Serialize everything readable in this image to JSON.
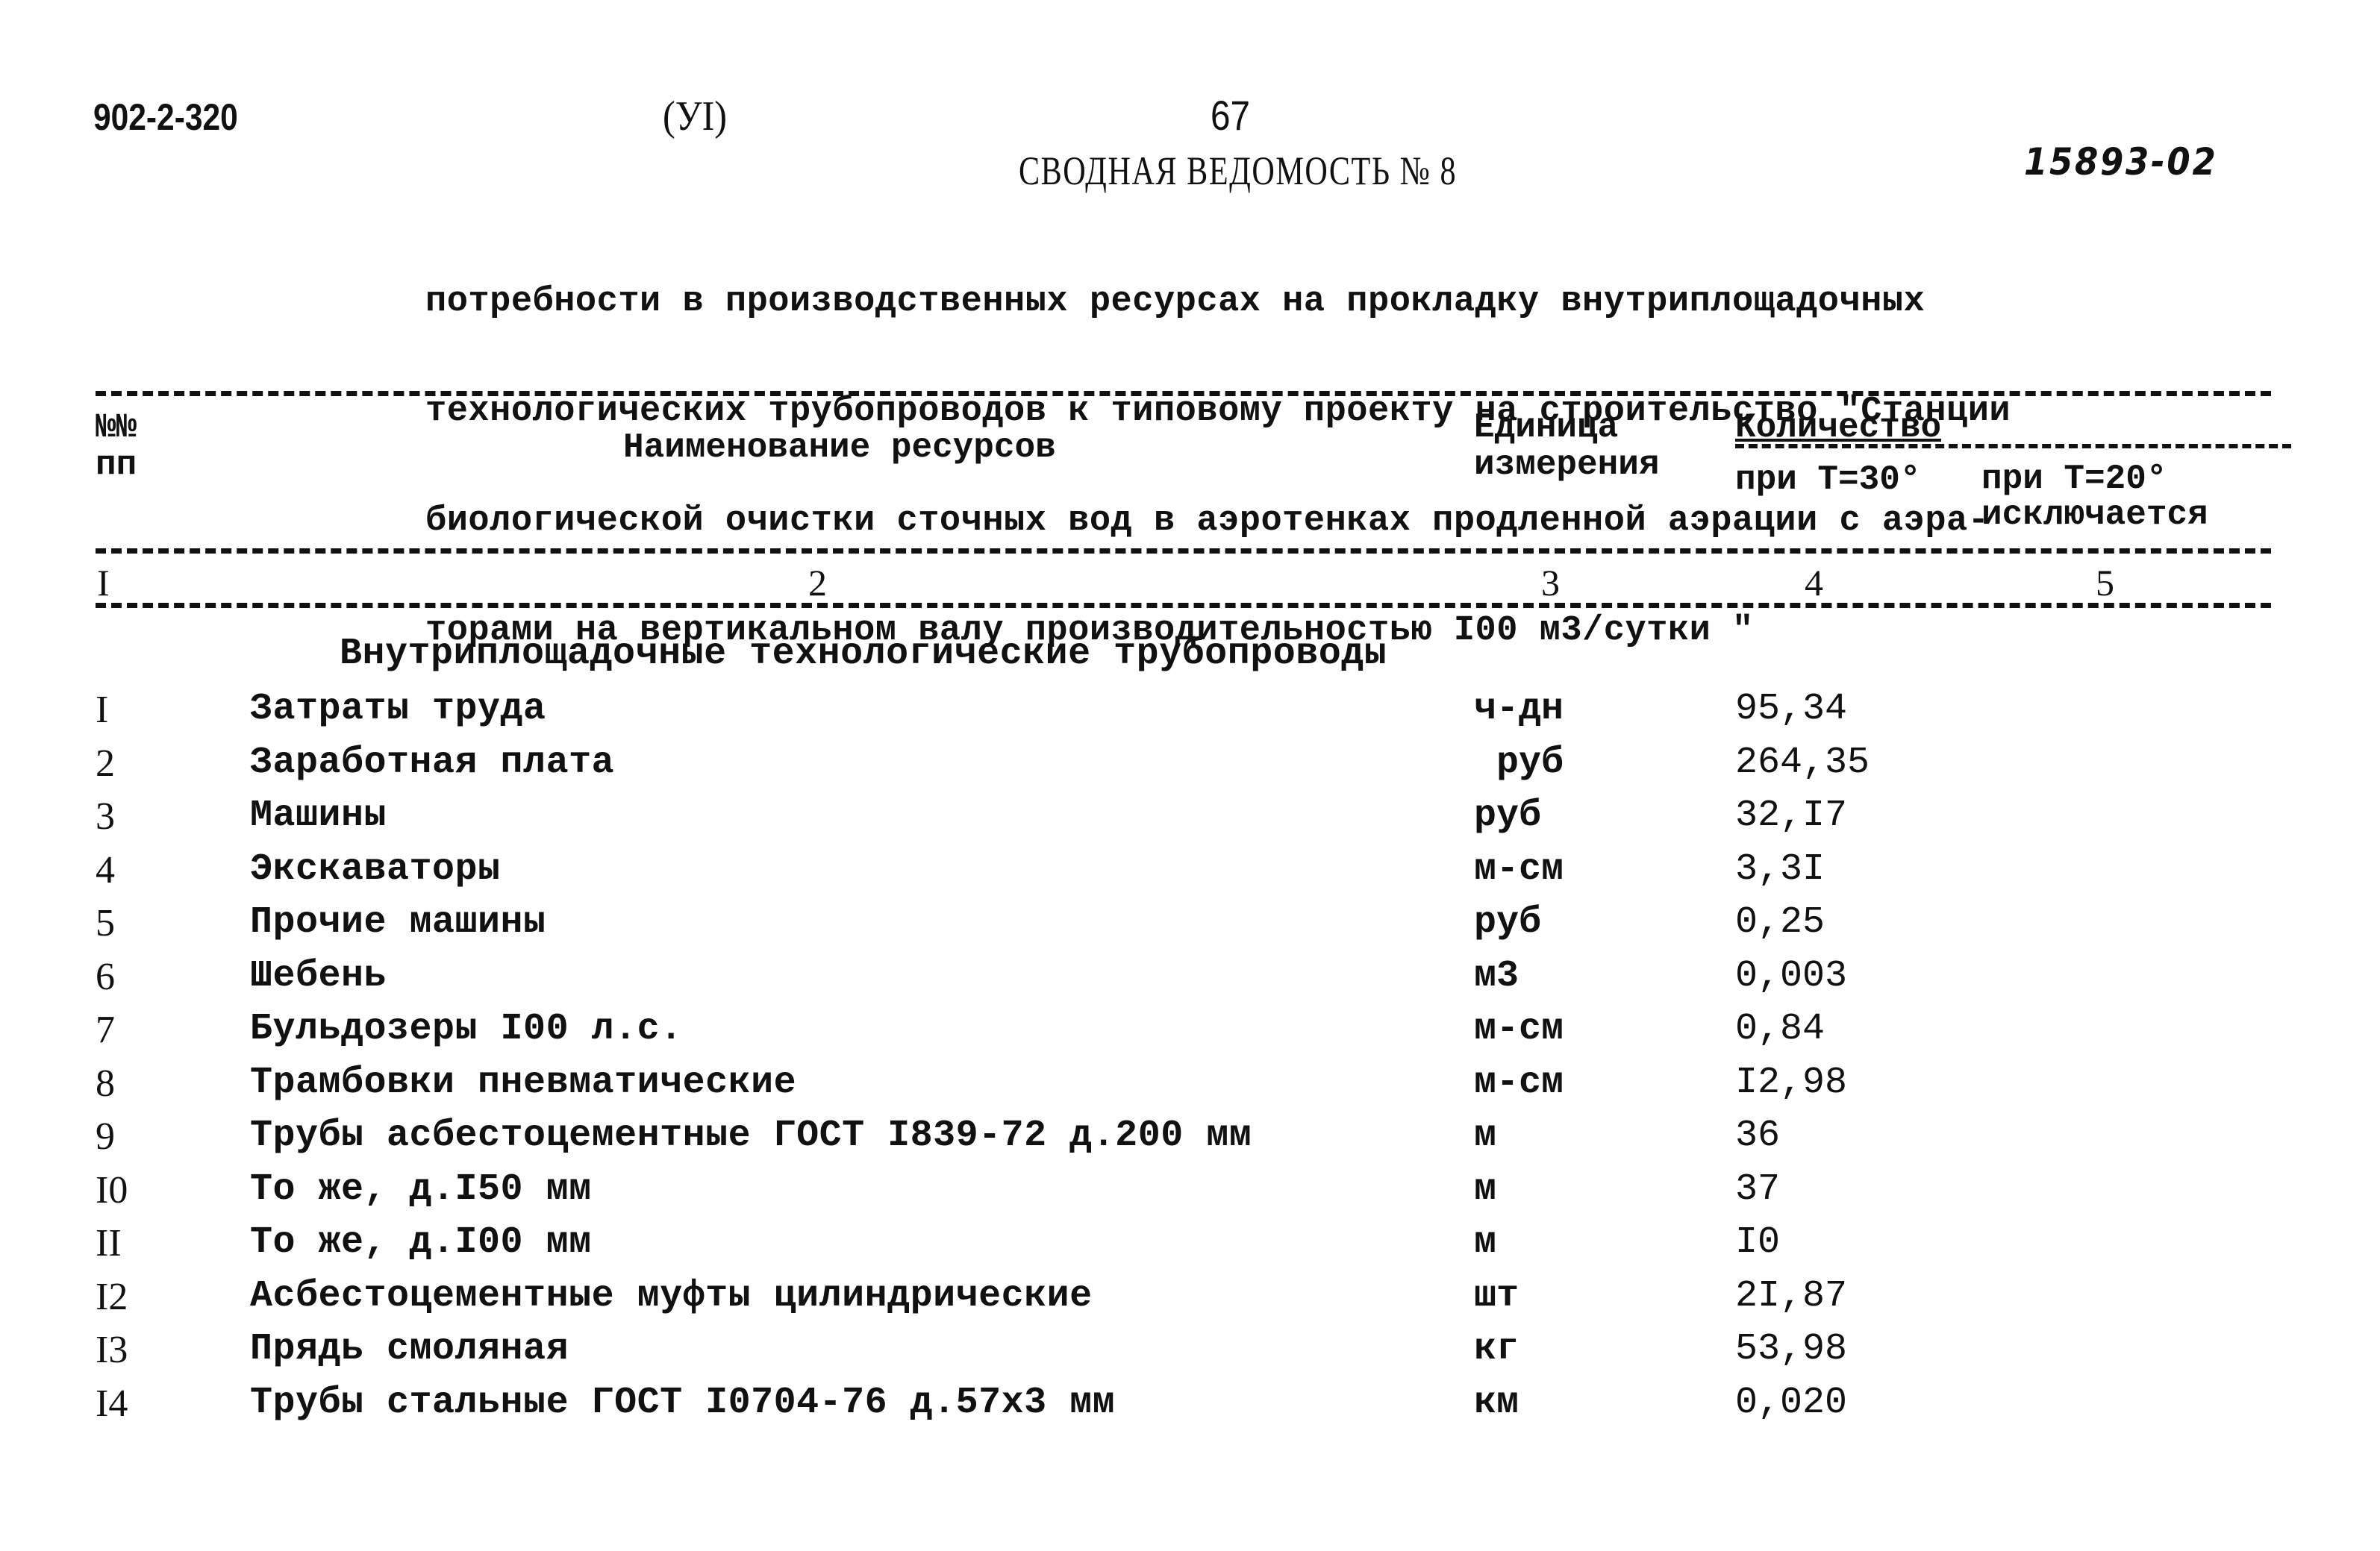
{
  "header": {
    "doc_code": "902-2-320",
    "section_code": "(УI)",
    "page_number": "67",
    "title": "СВОДНАЯ ВЕДОМОСТЬ № 8",
    "handwritten_number": "15893-02"
  },
  "description_lines": [
    "потребности в производственных ресурсах на прокладку внутриплощадочных",
    "технологических трубопроводов к типовому проекту на строительство \"Станции",
    "биологической очистки сточных вод в аэротенках продленной аэрации с аэра-",
    "торами на вертикальном валу производительностью I00 м3/сутки \""
  ],
  "table": {
    "columns": {
      "num": "№№\nпп",
      "name": "Наименование ресурсов",
      "unit": "Единица\nизмерения",
      "quantity": "Количество",
      "qty_t30": "при Т=30°",
      "qty_t20": "при Т=20°\nисключается"
    },
    "column_numbers": [
      "I",
      "2",
      "3",
      "4",
      "5"
    ],
    "section_title": "Внутриплощадочные технологические трубопроводы",
    "rows": [
      {
        "num": "I",
        "name": "Затраты труда",
        "unit": "ч-дн",
        "qty_t30": "95,34",
        "qty_t20": ""
      },
      {
        "num": "2",
        "name": "Заработная плата",
        "unit": " руб",
        "qty_t30": "264,35",
        "qty_t20": ""
      },
      {
        "num": "3",
        "name": "Машины",
        "unit": "руб",
        "qty_t30": "32,I7",
        "qty_t20": ""
      },
      {
        "num": "4",
        "name": "Экскаваторы",
        "unit": "м-см",
        "qty_t30": "3,3I",
        "qty_t20": ""
      },
      {
        "num": "5",
        "name": "Прочие машины",
        "unit": "руб",
        "qty_t30": "0,25",
        "qty_t20": ""
      },
      {
        "num": "6",
        "name": "Шебень",
        "unit": "м3",
        "qty_t30": "0,003",
        "qty_t20": ""
      },
      {
        "num": "7",
        "name": "Бульдозеры I00 л.с.",
        "unit": "м-см",
        "qty_t30": "0,84",
        "qty_t20": ""
      },
      {
        "num": "8",
        "name": "Трамбовки пневматические",
        "unit": "м-см",
        "qty_t30": "I2,98",
        "qty_t20": ""
      },
      {
        "num": "9",
        "name": "Трубы асбестоцементные ГОСТ I839-72 д.200 мм",
        "unit": "м",
        "qty_t30": "36",
        "qty_t20": ""
      },
      {
        "num": "I0",
        "name": "То же, д.I50 мм",
        "unit": "м",
        "qty_t30": "37",
        "qty_t20": ""
      },
      {
        "num": "II",
        "name": "То же, д.I00 мм",
        "unit": "м",
        "qty_t30": "I0",
        "qty_t20": ""
      },
      {
        "num": "I2",
        "name": "Асбестоцементные муфты цилиндрические",
        "unit": "шт",
        "qty_t30": "2I,87",
        "qty_t20": ""
      },
      {
        "num": "I3",
        "name": "Прядь смоляная",
        "unit": "кг",
        "qty_t30": "53,98",
        "qty_t20": ""
      },
      {
        "num": "I4",
        "name": "Трубы стальные ГОСТ I0704-76 д.57х3 мм",
        "unit": "км",
        "qty_t30": "0,020",
        "qty_t20": ""
      }
    ]
  }
}
